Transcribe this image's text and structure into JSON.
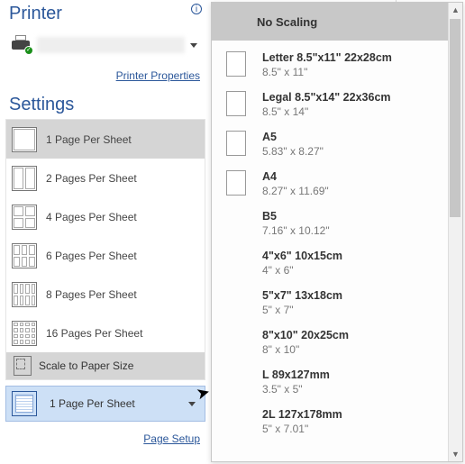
{
  "printer": {
    "heading": "Printer",
    "properties_link": "Printer Properties"
  },
  "settings": {
    "heading": "Settings",
    "pages_options": [
      {
        "label": "1 Page Per Sheet",
        "grid": "ic1",
        "cells": 1
      },
      {
        "label": "2 Pages Per Sheet",
        "grid": "ic2",
        "cells": 2
      },
      {
        "label": "4 Pages Per Sheet",
        "grid": "ic4",
        "cells": 4
      },
      {
        "label": "6 Pages Per Sheet",
        "grid": "ic6",
        "cells": 6
      },
      {
        "label": "8 Pages Per Sheet",
        "grid": "ic8",
        "cells": 8
      },
      {
        "label": "16 Pages Per Sheet",
        "grid": "ic16",
        "cells": 16
      }
    ],
    "scale_label": "Scale to Paper Size",
    "selected_label": "1 Page Per Sheet",
    "page_setup_link": "Page Setup"
  },
  "paper_menu": {
    "no_scaling": "No Scaling",
    "items": [
      {
        "title": "Letter 8.5\"x11\" 22x28cm",
        "sub": "8.5\" x 11\"",
        "thumb": true
      },
      {
        "title": "Legal 8.5\"x14\" 22x36cm",
        "sub": "8.5\" x 14\"",
        "thumb": true
      },
      {
        "title": "A5",
        "sub": "5.83\" x 8.27\"",
        "thumb": true
      },
      {
        "title": "A4",
        "sub": "8.27\" x 11.69\"",
        "thumb": true
      },
      {
        "title": "B5",
        "sub": "7.16\" x 10.12\"",
        "thumb": false
      },
      {
        "title": "4\"x6\" 10x15cm",
        "sub": "4\" x 6\"",
        "thumb": false
      },
      {
        "title": "5\"x7\" 13x18cm",
        "sub": "5\" x 7\"",
        "thumb": false
      },
      {
        "title": "8\"x10\" 20x25cm",
        "sub": "8\" x 10\"",
        "thumb": false
      },
      {
        "title": "L 89x127mm",
        "sub": "3.5\" x 5\"",
        "thumb": false
      },
      {
        "title": "2L 127x178mm",
        "sub": "5\" x 7.01\"",
        "thumb": false
      }
    ]
  }
}
